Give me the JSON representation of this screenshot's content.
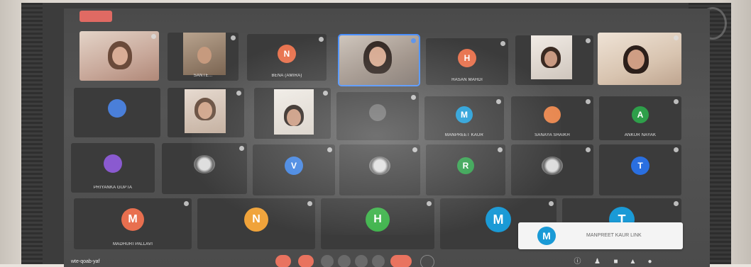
{
  "meeting": {
    "code": "wte-qoab-yaf",
    "colors": {
      "tile_bg": "#3b3b3b",
      "screen_bg": "#4a4a4a",
      "active_border": "#4a90ff",
      "end_call_red": "#e9735f"
    }
  },
  "tiles": [
    {
      "name": "",
      "type": "video"
    },
    {
      "name": "SANTE...",
      "type": "video"
    },
    {
      "name": "BENA (AMIRA)",
      "type": "avatar",
      "initial": "N",
      "color": "#e8734f"
    },
    {
      "name": "",
      "type": "video",
      "active": true
    },
    {
      "name": "HASAN MAHDI",
      "type": "avatar",
      "initial": "H",
      "color": "#e8734f"
    },
    {
      "name": "",
      "type": "video"
    },
    {
      "name": "",
      "type": "video"
    },
    {
      "name": "",
      "type": "avatar",
      "initial": "",
      "color": "#4a7fd9"
    },
    {
      "name": "",
      "type": "video"
    },
    {
      "name": "",
      "type": "video"
    },
    {
      "name": "",
      "type": "avatar",
      "initial": "",
      "color": "#6a6a6a"
    },
    {
      "name": "MANPREET KAUR",
      "type": "avatar",
      "initial": "M",
      "color": "#1a9ad6"
    },
    {
      "name": "SANAYA SHAIKH",
      "type": "avatar",
      "initial": "",
      "color": "#e8874f"
    },
    {
      "name": "ANKUR NAYAK",
      "type": "avatar",
      "initial": "A",
      "color": "#2e9f4a"
    },
    {
      "name": "PRIYANKA GUPTA",
      "type": "avatar",
      "initial": "",
      "color": "#8a5ad0"
    },
    {
      "name": "",
      "type": "photo"
    },
    {
      "name": "",
      "type": "avatar",
      "initial": "V",
      "color": "#3a7fe0"
    },
    {
      "name": "",
      "type": "photo"
    },
    {
      "name": "",
      "type": "avatar",
      "initial": "R",
      "color": "#2e9f4a"
    },
    {
      "name": "",
      "type": "photo"
    },
    {
      "name": "",
      "type": "avatar",
      "initial": "T",
      "color": "#2a6fe0"
    },
    {
      "name": "MADHURI PALLAVI",
      "type": "avatar",
      "initial": "M",
      "color": "#e86f4f"
    },
    {
      "name": "",
      "type": "avatar",
      "initial": "N",
      "color": "#f0a33a"
    },
    {
      "name": "",
      "type": "avatar",
      "initial": "H",
      "color": "#3db34a"
    },
    {
      "name": "",
      "type": "avatar",
      "initial": "M",
      "color": "#1a9ad6"
    },
    {
      "name": "",
      "type": "avatar",
      "initial": "T",
      "color": "#1a9ad6"
    }
  ],
  "toast": {
    "initial": "M",
    "text": "MANPREET KAUR LINK"
  },
  "toolbar": {
    "buttons": [
      "mic",
      "camera",
      "captions",
      "raise-hand",
      "present",
      "more",
      "end-call",
      "options"
    ]
  },
  "right_controls": {
    "icons": [
      "info",
      "people",
      "chat",
      "activities",
      "lock"
    ]
  }
}
